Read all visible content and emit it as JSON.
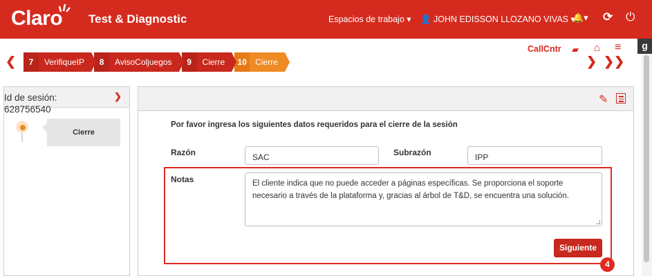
{
  "app": {
    "brand": "Claro",
    "title": "Test & Diagnostic"
  },
  "header": {
    "workspaces": "Espacios de trabajo ▾",
    "user": "JOHN EDISSON LLOZANO VIVAS ▾",
    "bell": "🔔▾",
    "g_badge": "g"
  },
  "steps": [
    {
      "num": "7",
      "label": "VerifiqueIP",
      "active": false
    },
    {
      "num": "8",
      "label": "AvisoColjuegos",
      "active": false
    },
    {
      "num": "9",
      "label": "Cierre",
      "active": false
    },
    {
      "num": "10",
      "label": "Cierre",
      "active": true
    }
  ],
  "toolbar": {
    "callcntr": "CallCntr"
  },
  "session": {
    "label": "Id de sesión:",
    "id": "628756540",
    "timeline_card": "Cierre"
  },
  "form": {
    "instructions": "Por favor ingresa los siguientes datos requeridos para el cierre de la sesión",
    "razon_label": "Razón",
    "razon_value": "SAC",
    "subrazon_label": "Subrazón",
    "subrazon_value": "IPP",
    "notas_label": "Notas",
    "notas_value": "El cliente indica que no puede acceder a páginas específicas. Se proporciona el soporte necesario a través de la plataforma y, gracias al árbol de T&D, se encuentra una solución.",
    "next_button": "Siguiente"
  },
  "annotation": {
    "step_marker": "4"
  },
  "colors": {
    "brand_red": "#d52b1e",
    "active_step": "#f08a24"
  }
}
